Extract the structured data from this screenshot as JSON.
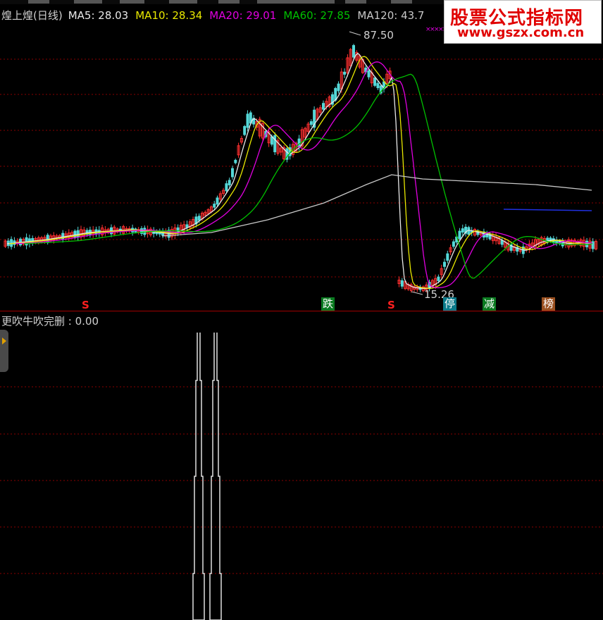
{
  "legend": {
    "title": "煌上煌(日线)",
    "ma5": "MA5: 28.03",
    "ma10": "MA10: 28.34",
    "ma20": "MA20: 29.01",
    "ma60": "MA60: 27.85",
    "ma120": "MA120: 43.7"
  },
  "watermark": {
    "name": "股票公式指标网",
    "url": "www.gszx.com.cn"
  },
  "price_chart": {
    "high_label": "87.50",
    "low_label": "15.26",
    "markers": [
      "S",
      "跌",
      "S",
      "停",
      "减",
      "榜"
    ]
  },
  "indicator": {
    "title": "更吹牛吹完删 : 0.00"
  },
  "colors": {
    "ma5": "#e8e8e8",
    "ma10": "#e8e800",
    "ma20": "#e000e0",
    "ma60": "#00c000",
    "ma120": "#c8c8c8",
    "up": "#ff3030",
    "down": "#54d8d8",
    "grid": "#8a0000"
  },
  "chart_data": {
    "type": "line",
    "title": "煌上煌(日线)",
    "series": [
      {
        "name": "MA5",
        "values": [
          28.03
        ]
      },
      {
        "name": "MA10",
        "values": [
          28.34
        ]
      },
      {
        "name": "MA20",
        "values": [
          29.01
        ]
      },
      {
        "name": "MA60",
        "values": [
          27.85
        ]
      }
    ],
    "annotations": [
      "87.50",
      "15.26"
    ],
    "indicator_value": 0.0
  }
}
